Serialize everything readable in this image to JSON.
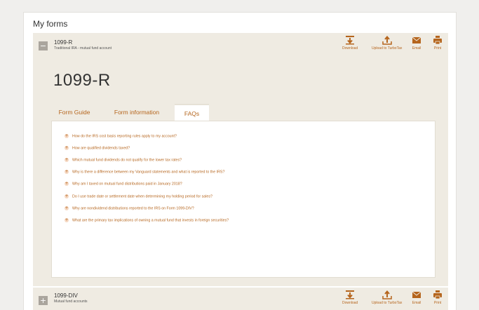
{
  "header": {
    "title": "My forms"
  },
  "forms": [
    {
      "name": "1099-R",
      "subtitle": "Traditional IRA - mutual fund account",
      "expanded_title": "1099-R",
      "toggle": "−"
    },
    {
      "name": "1099-DIV",
      "subtitle": "Mutual fund accounts",
      "toggle": "+"
    }
  ],
  "actions": {
    "download": "Download",
    "upload": "Upload to TurboTax",
    "email": "Email",
    "print": "Print"
  },
  "tabs": [
    {
      "label": "Form Guide",
      "active": false
    },
    {
      "label": "Form information",
      "active": false
    },
    {
      "label": "FAQs",
      "active": true
    }
  ],
  "faqs": [
    "How do the IRS cost basis reporting rules apply to my account?",
    "How are qualified dividends taxed?",
    "Which mutual fund dividends do not qualify for the lower tax rates?",
    "Why is there a difference between my Vanguard statements and what is reported to the IRS?",
    "Why am I taxed on mutual fund distributions paid in January 2018?",
    "Do I use trade date or settlement date when determining my holding period for sales?",
    "Why are nondividend distributions reported to the IRS on Form 1099-DIV?",
    "What are the primary tax implications of owning a mutual fund that invests in foreign securities?"
  ],
  "icons": {
    "download": "download-icon",
    "upload": "upload-icon",
    "email": "envelope-icon",
    "print": "printer-icon",
    "expand": "plus-icon"
  },
  "colors": {
    "accent": "#b5651d",
    "panel": "#efebe2"
  }
}
